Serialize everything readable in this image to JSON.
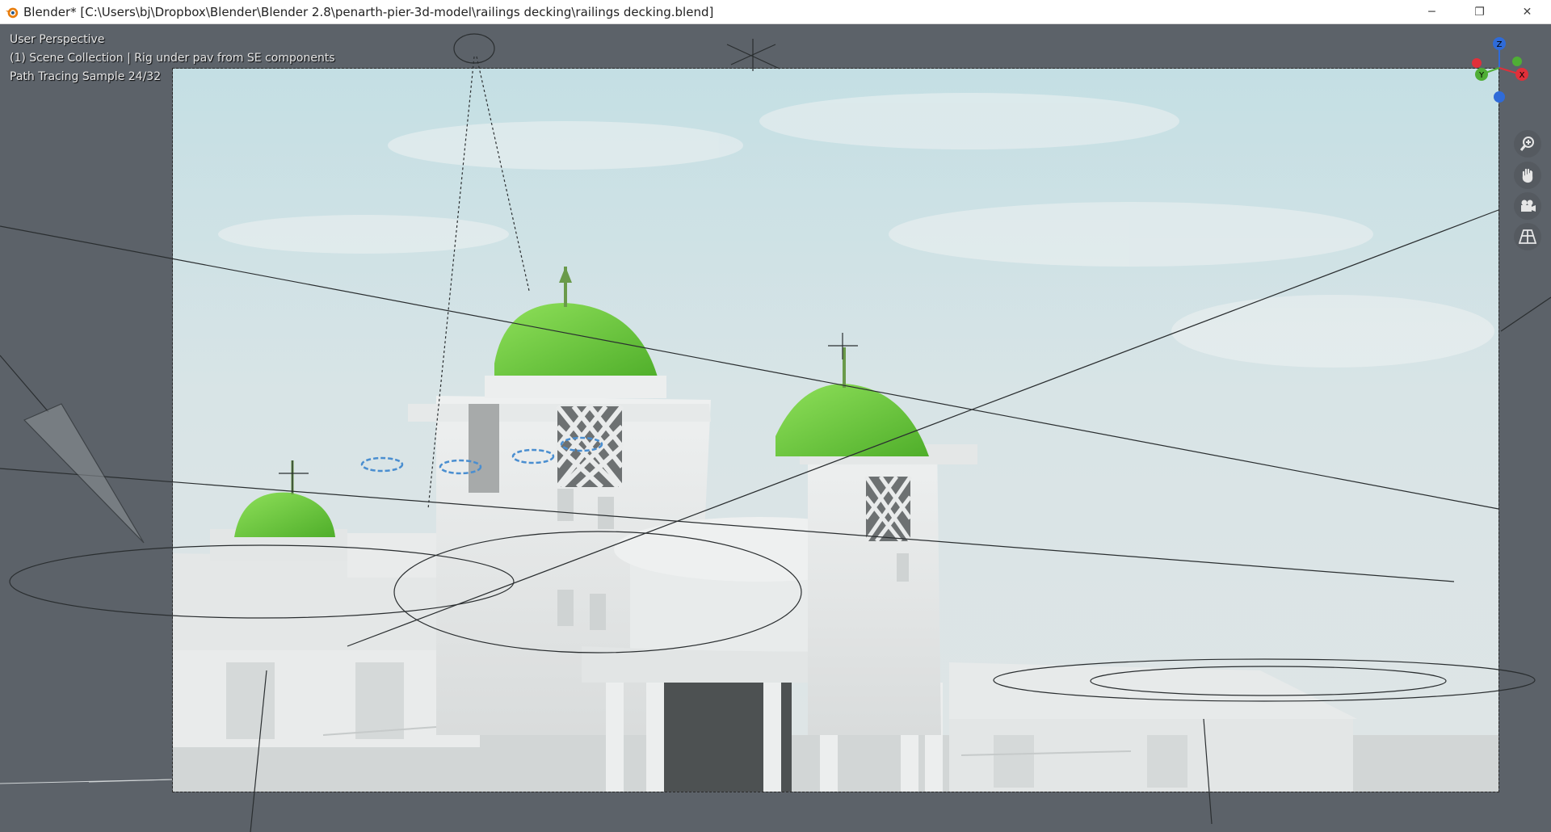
{
  "window": {
    "title": "Blender* [C:\\Users\\bj\\Dropbox\\Blender\\Blender 2.8\\penarth-pier-3d-model\\railings decking\\railings decking.blend]",
    "controls": {
      "minimize": "─",
      "restore": "❐",
      "close": "✕"
    }
  },
  "viewport": {
    "view_name": "User Perspective",
    "collection_info": "(1) Scene Collection | Rig under pav from SE components",
    "render_status": "Path Tracing Sample 24/32"
  },
  "gizmo": {
    "x_label": "X",
    "y_label": "Y",
    "z_label": "Z"
  },
  "nav_tools": [
    "zoom-icon",
    "pan-hand-icon",
    "camera-icon",
    "perspective-grid-icon"
  ],
  "colors": {
    "viewport_bg": "#5c6269",
    "dome_green": "#6ccc3c",
    "axis_x": "#e0303a",
    "axis_y": "#4fae35",
    "axis_z": "#2f6bd8"
  }
}
